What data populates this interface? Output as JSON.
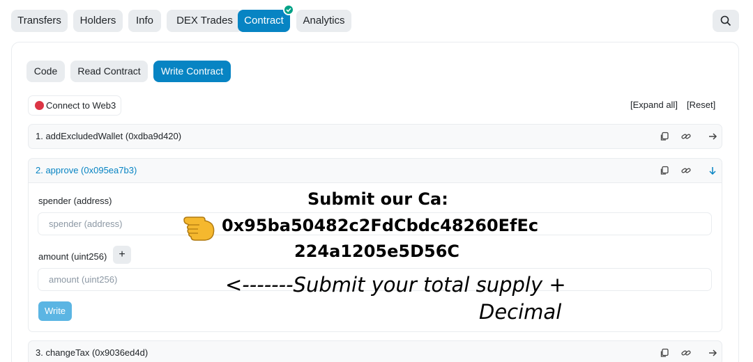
{
  "top_tabs": [
    {
      "label": "Transfers",
      "active": false
    },
    {
      "label": "Holders",
      "active": false
    },
    {
      "label": "Info",
      "active": false
    },
    {
      "label": "DEX Trades",
      "active": false
    },
    {
      "label": "Contract",
      "active": true,
      "verified": true
    },
    {
      "label": "Analytics",
      "active": false
    }
  ],
  "search": {
    "icon": "search-icon"
  },
  "sub_tabs": [
    {
      "label": "Code",
      "active": false
    },
    {
      "label": "Read Contract",
      "active": false
    },
    {
      "label": "Write Contract",
      "active": true
    }
  ],
  "web3": {
    "label": "Connect to Web3",
    "status_color": "#dc3545"
  },
  "links": {
    "expand_all": "[Expand all]",
    "reset": "[Reset]"
  },
  "functions": [
    {
      "title": "1. addExcludedWallet (0xdba9d420)",
      "expanded": false
    },
    {
      "title": "2. approve (0x095ea7b3)",
      "expanded": true
    },
    {
      "title": "3. changeTax (0x9036ed4d)",
      "expanded": false
    }
  ],
  "approve_form": {
    "spender_label": "spender (address)",
    "spender_placeholder": "spender (address)",
    "amount_label": "amount (uint256)",
    "amount_placeholder": "amount (uint256)",
    "plus_label": "+",
    "write_label": "Write"
  },
  "overlay": {
    "line1": "Submit our Ca:",
    "line2": "0x95ba50482c2FdCbdc48260EfEc",
    "line3": "224a1205e5D56C",
    "line4": "<-------Submit your total supply +",
    "line5": "Decimal"
  },
  "colors": {
    "accent": "#0784c3",
    "verified": "#00a186",
    "pill_bg": "#e9ecef"
  }
}
